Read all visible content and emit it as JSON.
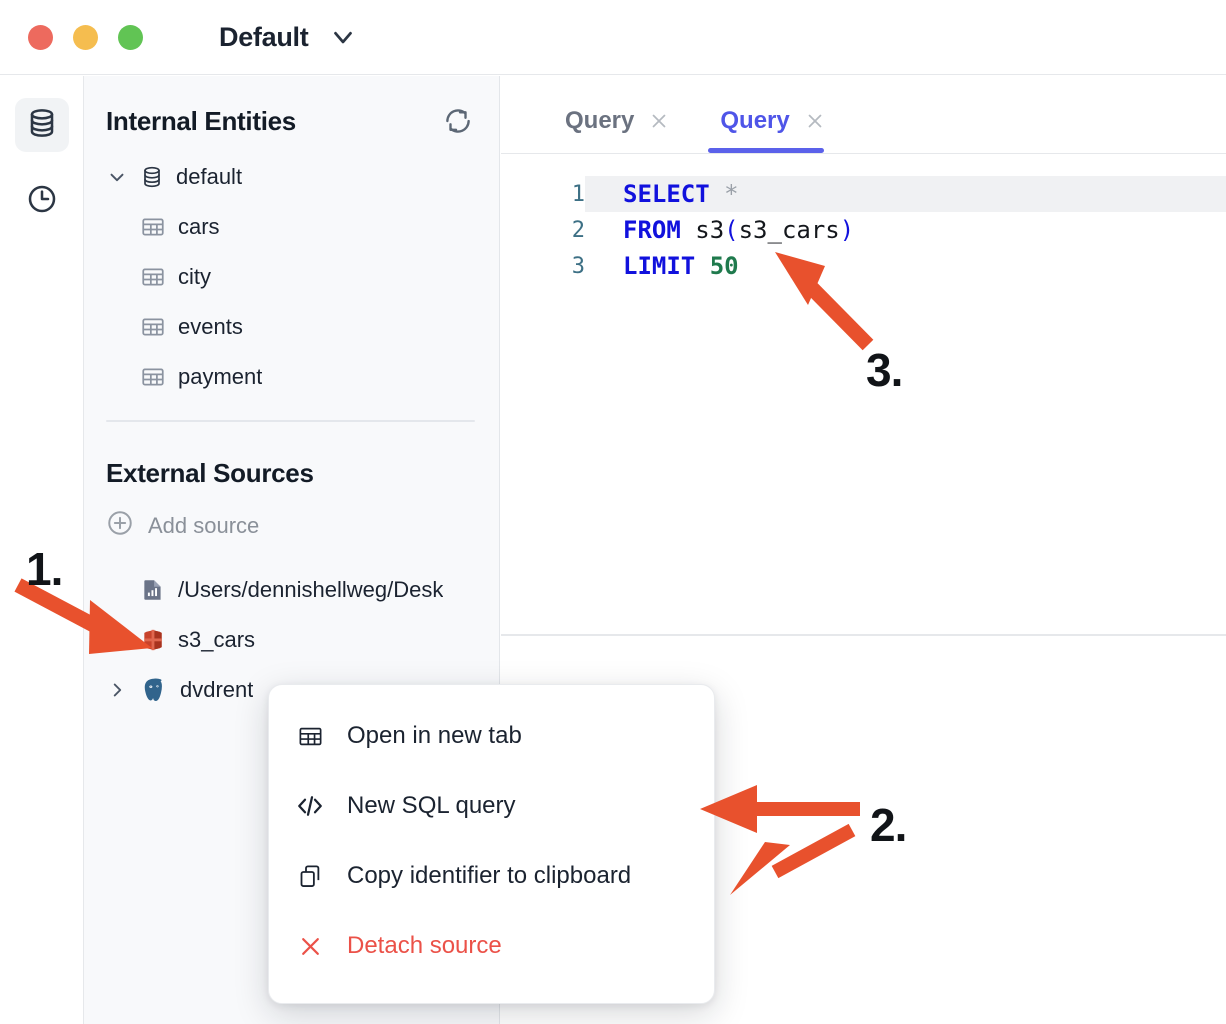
{
  "window": {
    "workspace_name": "Default",
    "traffic_lights": [
      "close-red",
      "minimize-yellow",
      "maximize-green"
    ],
    "caret_icon": "chevron-down-icon"
  },
  "rail": {
    "items": [
      {
        "icon": "database-icon",
        "name": "database-rail-button",
        "active": true
      },
      {
        "icon": "clock-history-icon",
        "name": "history-rail-button",
        "active": false
      }
    ]
  },
  "sidebar": {
    "internal": {
      "title": "Internal Entities",
      "refresh_icon": "refresh-icon",
      "root": {
        "label": "default",
        "icon": "database-icon",
        "expanded": true,
        "chevron": "chevron-down-icon"
      },
      "tables": [
        {
          "label": "cars",
          "icon": "table-icon"
        },
        {
          "label": "city",
          "icon": "table-icon"
        },
        {
          "label": "events",
          "icon": "table-icon"
        },
        {
          "label": "payment",
          "icon": "table-icon"
        }
      ]
    },
    "external": {
      "title": "External Sources",
      "add_source_label": "Add source",
      "add_source_icon": "plus-circle-icon",
      "sources": [
        {
          "label": "/Users/dennishellweg/Desk",
          "icon": "file-chart-icon",
          "chevron": null
        },
        {
          "label": "s3_cars",
          "icon": "aws-s3-icon",
          "chevron": null
        },
        {
          "label": "dvdrent",
          "icon": "postgresql-icon",
          "chevron": "chevron-right-icon"
        }
      ]
    }
  },
  "editor": {
    "tabs": [
      {
        "label": "Query",
        "active": false,
        "close_icon": "close-icon"
      },
      {
        "label": "Query",
        "active": true,
        "close_icon": "close-icon"
      }
    ],
    "active_tab_color": "#5b61ea",
    "lines": [
      {
        "number": "1",
        "active": true,
        "tokens": [
          {
            "t": "SELECT",
            "c": "kw"
          },
          {
            "t": " ",
            "c": "id"
          },
          {
            "t": "*",
            "c": "star"
          }
        ]
      },
      {
        "number": "2",
        "active": false,
        "tokens": [
          {
            "t": "FROM",
            "c": "kw"
          },
          {
            "t": " ",
            "c": "id"
          },
          {
            "t": "s3",
            "c": "id"
          },
          {
            "t": "(",
            "c": "pun"
          },
          {
            "t": "s3_cars",
            "c": "id"
          },
          {
            "t": ")",
            "c": "pun"
          }
        ]
      },
      {
        "number": "3",
        "active": false,
        "tokens": [
          {
            "t": "LIMIT",
            "c": "kw"
          },
          {
            "t": " ",
            "c": "id"
          },
          {
            "t": "50",
            "c": "num"
          }
        ]
      }
    ],
    "sql_text": "SELECT *\nFROM s3(s3_cars)\nLIMIT 50"
  },
  "context_menu": {
    "items": [
      {
        "label": "Open in new tab",
        "icon": "table-icon",
        "danger": false
      },
      {
        "label": "New SQL query",
        "icon": "code-icon",
        "danger": false
      },
      {
        "label": "Copy identifier to clipboard",
        "icon": "clipboard-icon",
        "danger": false
      },
      {
        "label": "Detach source",
        "icon": "close-x-icon",
        "danger": true
      }
    ],
    "danger_color": "#eb5148"
  },
  "annotations": {
    "arrow_color": "#e8512d",
    "steps": [
      {
        "number": "1.",
        "target": "s3-cars-source-row"
      },
      {
        "number": "2.",
        "target": "context-menu-items"
      },
      {
        "number": "3.",
        "target": "sql-query-text"
      }
    ]
  }
}
